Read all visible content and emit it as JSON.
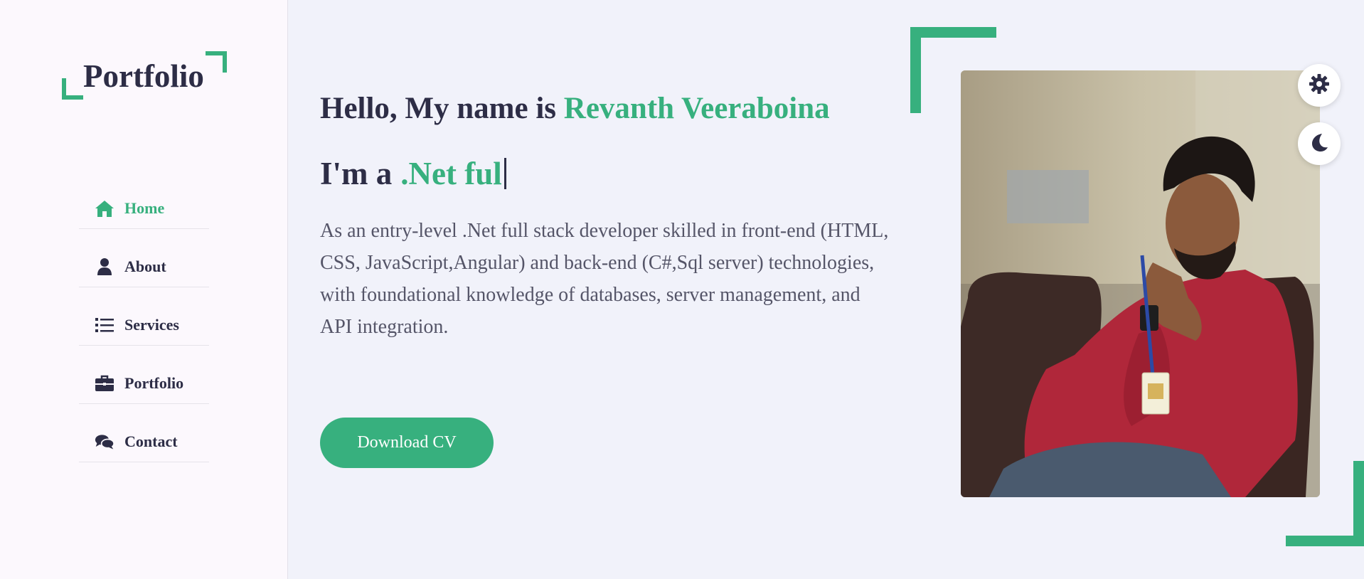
{
  "logo": {
    "text": "Portfolio"
  },
  "nav": {
    "items": [
      {
        "label": "Home",
        "icon": "home-icon",
        "active": true
      },
      {
        "label": "About",
        "icon": "user-icon",
        "active": false
      },
      {
        "label": "Services",
        "icon": "list-icon",
        "active": false
      },
      {
        "label": "Portfolio",
        "icon": "briefcase-icon",
        "active": false
      },
      {
        "label": "Contact",
        "icon": "comments-icon",
        "active": false
      }
    ]
  },
  "hero": {
    "greeting": "Hello, My name is",
    "name": "Revanth Veeraboina",
    "role_prefix": "I'm a",
    "role_text": ".Net ful",
    "description": "As an entry-level .Net full stack developer skilled in front-end (HTML, CSS, JavaScript,Angular) and back-end (C#,Sql server) technologies, with foundational knowledge of databases, server management, and API integration.",
    "cv_button": "Download CV"
  },
  "controls": {
    "settings_icon": "gear-icon",
    "theme_icon": "moon-icon"
  },
  "colors": {
    "accent": "#37b07e",
    "text": "#2d2d46",
    "background": "#f1f2fa",
    "sidebar": "#fcf8fd"
  }
}
